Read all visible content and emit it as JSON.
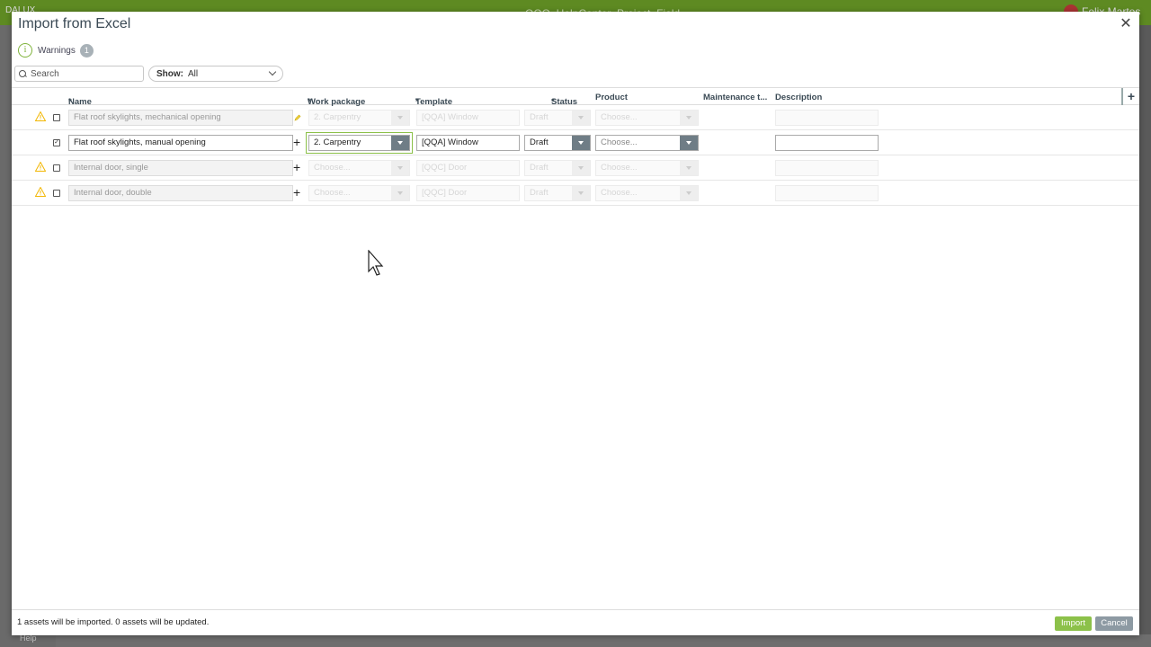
{
  "background": {
    "logo": "DALUX",
    "title": "QQQ_HelpCenter_Project_Field",
    "user": "Felix Martos",
    "help": "Help"
  },
  "dialog": {
    "title": "Import from Excel",
    "warnings_label": "Warnings",
    "warnings_count": "1",
    "search_placeholder": "Search",
    "show_label": "Show:",
    "show_value": "All"
  },
  "columns": {
    "name": "Name",
    "work_package": "Work package",
    "template": "Template",
    "status": "Status",
    "product": "Product",
    "maintenance": "Maintenance t...",
    "description": "Description",
    "required_mark": "*"
  },
  "rows": [
    {
      "warning": true,
      "checked": false,
      "name": "Flat roof skylights, mechanical opening",
      "work_package": "2. Carpentry",
      "template": "[QQA] Window",
      "status": "Draft",
      "product": "Choose...",
      "description": ""
    },
    {
      "warning": false,
      "checked": true,
      "name": "Flat roof skylights, manual opening",
      "work_package": "2. Carpentry",
      "template": "[QQA] Window",
      "status": "Draft",
      "product": "Choose...",
      "description": ""
    },
    {
      "warning": true,
      "checked": false,
      "name": "Internal door, single",
      "work_package": "Choose...",
      "template": "[QQC] Door",
      "status": "Draft",
      "product": "Choose...",
      "description": ""
    },
    {
      "warning": true,
      "checked": false,
      "name": "Internal door, double",
      "work_package": "Choose...",
      "template": "[QQC] Door",
      "status": "Draft",
      "product": "Choose...",
      "description": ""
    }
  ],
  "footer": {
    "summary": "1 assets will be imported. 0 assets will be updated.",
    "import_label": "Import",
    "cancel_label": "Cancel"
  },
  "colors": {
    "accent_green": "#8cc14a",
    "warning_yellow": "#f2b705",
    "required_orange": "#e8841a"
  }
}
